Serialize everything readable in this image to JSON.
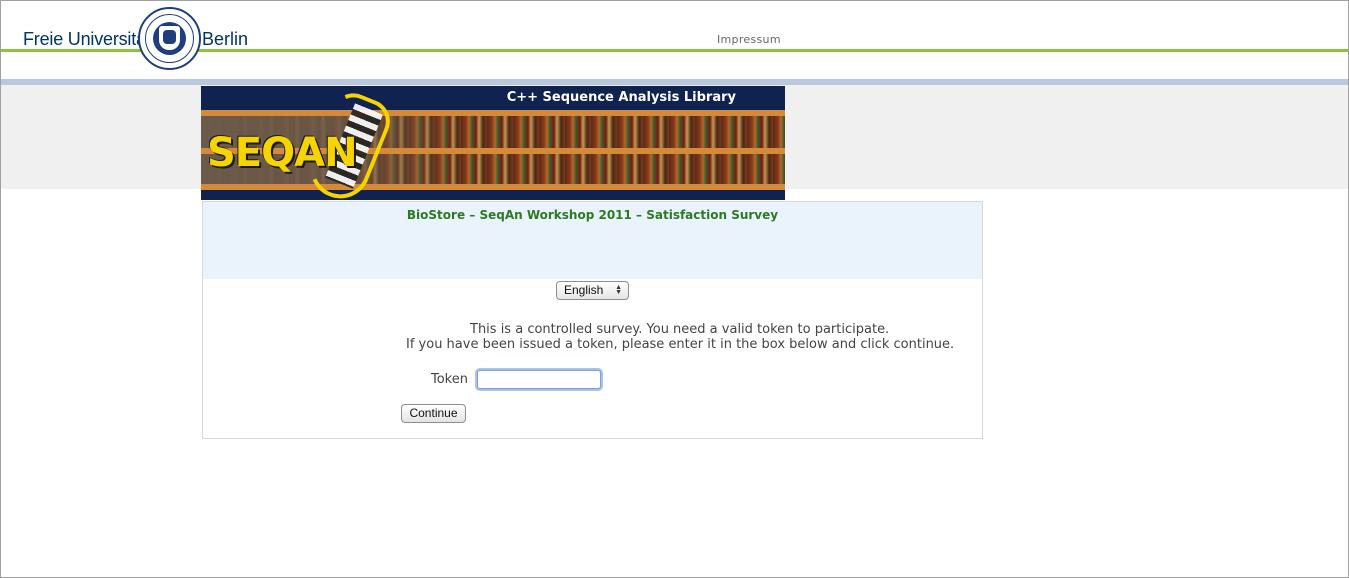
{
  "header": {
    "brand_left": "Freie Universität",
    "brand_right": "Berlin",
    "impressum_link": "Impressum",
    "seal_icon": "fu-berlin-seal-icon"
  },
  "banner": {
    "title": "C++ Sequence Analysis Library",
    "logo_text": "SEQAN"
  },
  "survey": {
    "title": "BioStore – SeqAn Workshop 2011 – Satisfaction Survey",
    "language_selected": "English",
    "message_line1": "This is a controlled survey. You need a valid token to participate.",
    "message_line2": "If you have been issued a token, please enter it in the box below and click continue.",
    "token_label": "Token",
    "token_value": "",
    "continue_label": "Continue"
  },
  "colors": {
    "fu_green": "#8cc33a",
    "fu_blue": "#003366",
    "survey_title_green": "#2d7a23",
    "banner_navy": "#10224f",
    "seqan_yellow": "#f5d400"
  }
}
